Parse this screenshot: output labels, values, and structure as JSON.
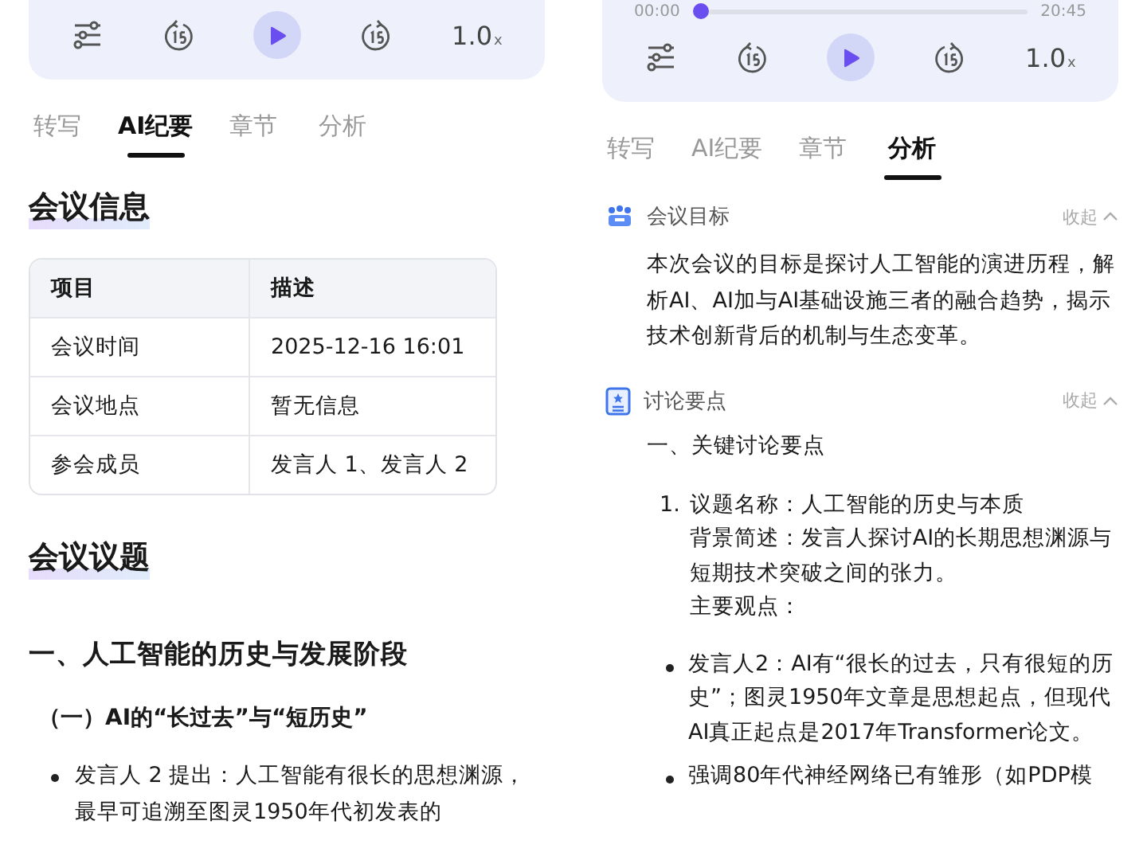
{
  "panels": [
    {
      "player": {
        "speed": "1.0",
        "speed_unit": "x"
      },
      "tabs": [
        {
          "label": "转写",
          "selected": false
        },
        {
          "label": "AI纪要",
          "selected": true
        },
        {
          "label": "章节",
          "selected": false
        },
        {
          "label": "分析",
          "selected": false
        }
      ],
      "blocks": [
        {
          "kind": "heading",
          "text": "会议信息"
        },
        {
          "kind": "table",
          "columns": [
            "项目",
            "描述"
          ],
          "rows": [
            [
              "会议时间",
              "2025-12-16 16:01"
            ],
            [
              "会议地点",
              "暂无信息"
            ],
            [
              "参会成员",
              "发言人 1、发言人 2"
            ]
          ]
        },
        {
          "kind": "heading",
          "text": "会议议题"
        },
        {
          "kind": "title",
          "text": "一、人工智能的历史与发展阶段"
        },
        {
          "kind": "subtitle",
          "text": "（一）AI的“长过去”与“短历史”"
        },
        {
          "kind": "bullet",
          "text": "发言人 2 提出：人工智能有很长的思想渊源，最早可追溯至图灵1950年代初发表的"
        }
      ]
    },
    {
      "player": {
        "times": {
          "current": "00:00",
          "total": "20:45",
          "level": 0
        },
        "speed": "1.0",
        "speed_unit": "x"
      },
      "tabs": [
        {
          "label": "转写",
          "selected": false
        },
        {
          "label": "AI纪要",
          "selected": false
        },
        {
          "label": "章节",
          "selected": false
        },
        {
          "label": "分析",
          "selected": true
        }
      ],
      "blocks": [
        {
          "kind": "section",
          "text": "会议目标",
          "action": "收起"
        },
        {
          "kind": "paragraph",
          "text": "本次会议的目标是探讨人工智能的演进历程，解析AI、AI加与AI基础设施三者的融合趋势，揭示技术创新背后的机制与生态变革。"
        },
        {
          "kind": "section",
          "text": "讨论要点",
          "action": "收起"
        },
        {
          "kind": "point_title",
          "text": "一、关键讨论要点"
        },
        {
          "kind": "numbered",
          "number": "1.",
          "lines": [
            "议题名称：人工智能的历史与本质",
            "背景简述：发言人探讨AI的长期思想渊源与短期技术突破之间的张力。",
            "主要观点："
          ]
        },
        {
          "kind": "sub_bullet",
          "text": "发言人2：AI有“很长的过去，只有很短的历史”；图灵1950年文章是思想起点，但现代AI真正起点是2017年Transformer论文。"
        },
        {
          "kind": "sub_bullet",
          "text": "强调80年代神经网络已有雏形（如PDP模"
        }
      ]
    }
  ]
}
